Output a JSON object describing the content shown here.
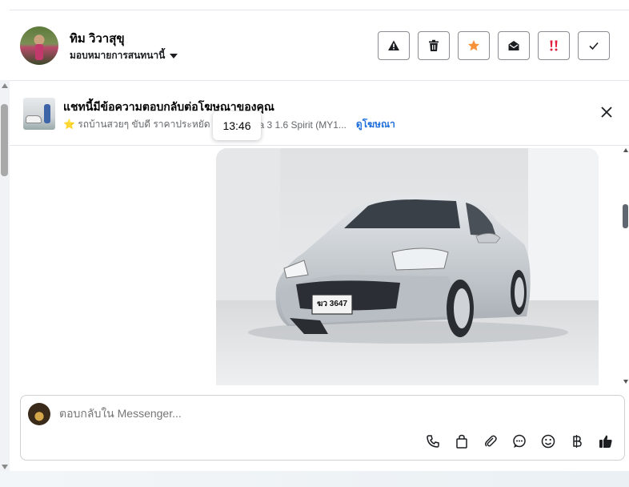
{
  "header": {
    "user_name": "ทิม วิวาสุขุ",
    "assign_label": "มอบหมายการสนทนานี้",
    "actions": [
      {
        "name": "report-button",
        "icon": "warning-icon"
      },
      {
        "name": "delete-button",
        "icon": "trash-icon"
      },
      {
        "name": "star-button",
        "icon": "star-icon"
      },
      {
        "name": "mark-unread-button",
        "icon": "envelope-open-icon"
      },
      {
        "name": "follow-up-button",
        "icon": "double-exclamation-icon"
      },
      {
        "name": "done-button",
        "icon": "check-icon"
      }
    ],
    "colors": {
      "star": "#f7923a",
      "follow_up": "#e41e3f"
    }
  },
  "banner": {
    "title": "แชทนี้มีข้อความตอบกลับต่อโฆษณาของคุณ",
    "subtitle_pre": "⭐ รถบ้านสวยๆ ขับดี ราคาประหยัด 🚗",
    "subtitle_post": "zda 3 1.6 Spirit (MY1...",
    "link": "ดูโฆษณา",
    "link_color": "#216fdb"
  },
  "tooltip": {
    "time": "13:46"
  },
  "photo": {
    "plate_line1": "ฆว 3647"
  },
  "composer": {
    "placeholder": "ตอบกลับใน Messenger...",
    "tools": [
      "phone-icon",
      "shopping-bag-icon",
      "paperclip-icon",
      "chat-bubble-icon",
      "emoji-icon",
      "baht-icon",
      "like-icon"
    ]
  }
}
